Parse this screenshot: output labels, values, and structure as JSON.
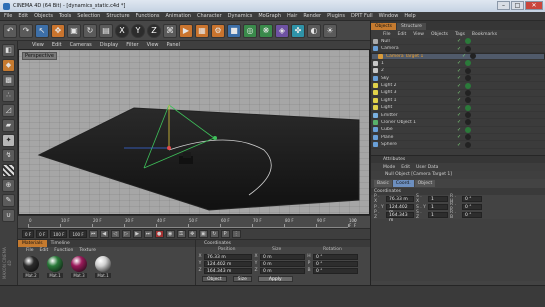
{
  "window": {
    "title": "CINEMA 4D (64 Bit) - [dynamics_static.c4d *]",
    "minimize_glyph": "–",
    "maximize_glyph": "□",
    "close_glyph": "✕"
  },
  "menubar": [
    "File",
    "Edit",
    "Objects",
    "Tools",
    "Selection",
    "Structure",
    "Functions",
    "Animation",
    "Character",
    "Dynamics",
    "MoGraph",
    "Hair",
    "Render",
    "Plugins",
    "DPIT Full",
    "Window",
    "Help"
  ],
  "toolbar": {
    "axis_x": "X",
    "axis_y": "Y",
    "axis_z": "Z"
  },
  "viewport": {
    "menu": [
      "View",
      "Edit",
      "Cameras",
      "Display",
      "Filter",
      "View",
      "Panel"
    ],
    "label": "Perspective"
  },
  "timeline": {
    "ticks": [
      "0",
      "10 F",
      "20 F",
      "30 F",
      "40 F",
      "50 F",
      "60 F",
      "70 F",
      "80 F",
      "90 F",
      "100 F"
    ],
    "end_marker": "0 F"
  },
  "playback": {
    "start": "0 F",
    "current": "0 F",
    "end": "100 F",
    "max": "100 F"
  },
  "materials": {
    "tabs": [
      "Materials",
      "Timeline"
    ],
    "active_tab": "Materials",
    "menu": [
      "File",
      "Edit",
      "Function",
      "Texture"
    ],
    "items": [
      {
        "name": "Mat.2",
        "color": "#2b2b2b"
      },
      {
        "name": "Mat.1",
        "color": "#2a7a3a"
      },
      {
        "name": "Mat.3",
        "color": "#9a1a5a"
      },
      {
        "name": "Mat.1",
        "color": "#cfcfcf"
      }
    ]
  },
  "coordinates": {
    "title": "Coordinates",
    "headers": [
      "Position",
      "Size",
      "Rotation"
    ],
    "rows": [
      {
        "axis": "X",
        "pos": "76.33 m",
        "size": "0 m",
        "rot_label": "H",
        "rot": "0 °"
      },
      {
        "axis": "Y",
        "pos": "124.402 m",
        "size": "0 m",
        "rot_label": "P",
        "rot": "0 °"
      },
      {
        "axis": "Z",
        "pos": "164.343 m",
        "size": "0 m",
        "rot_label": "B",
        "rot": "0 °"
      }
    ],
    "mode": "Object",
    "size_mode": "Size",
    "apply": "Apply"
  },
  "objects_panel": {
    "tabs": [
      "Objects",
      "Structure"
    ],
    "active_tab": "Objects",
    "menu": [
      "File",
      "Edit",
      "View",
      "Objects",
      "Tags",
      "Bookmarks"
    ],
    "items": [
      {
        "name": "Null",
        "color": "#aaaaaa",
        "highlight": false,
        "selected": false
      },
      {
        "name": "Camera",
        "color": "#6aa0d8",
        "highlight": false,
        "selected": false
      },
      {
        "name": "Camera Target 1",
        "color": "#d89a3a",
        "highlight": true,
        "selected": true
      },
      {
        "name": "1",
        "color": "#c8c8c8",
        "highlight": false,
        "selected": false
      },
      {
        "name": "2",
        "color": "#c8c8c8",
        "highlight": false,
        "selected": false
      },
      {
        "name": "Sky",
        "color": "#6aa0d8",
        "highlight": false,
        "selected": false
      },
      {
        "name": "Light 2",
        "color": "#e0d24a",
        "highlight": false,
        "selected": false
      },
      {
        "name": "Light 3",
        "color": "#e0d24a",
        "highlight": false,
        "selected": false
      },
      {
        "name": "Light 1",
        "color": "#e0d24a",
        "highlight": false,
        "selected": false
      },
      {
        "name": "Light",
        "color": "#e0d24a",
        "highlight": false,
        "selected": false
      },
      {
        "name": "Emitter",
        "color": "#7ab0e0",
        "highlight": false,
        "selected": false
      },
      {
        "name": "Cloner Object 1",
        "color": "#58b06a",
        "highlight": false,
        "selected": false
      },
      {
        "name": "Cube",
        "color": "#6aa0d8",
        "highlight": false,
        "selected": false
      },
      {
        "name": "Plane",
        "color": "#6aa0d8",
        "highlight": false,
        "selected": false
      },
      {
        "name": "Sphere",
        "color": "#6aa0d8",
        "highlight": false,
        "selected": false
      }
    ]
  },
  "attributes": {
    "title": "Attributes",
    "menu": [
      "Mode",
      "Edit",
      "User Data"
    ],
    "object_name": "Null Object [Camera Target 1]",
    "tabs": [
      "Basic",
      "Coord.",
      "Object"
    ],
    "active_tab": "Coord.",
    "section": "Coordinates",
    "rows": [
      {
        "p_label": "P . X",
        "p": "76.33 m",
        "s_label": "S . X",
        "s": "1",
        "r_label": "R . H",
        "r": "0 °"
      },
      {
        "p_label": "P . Y",
        "p": "124.402 m",
        "s_label": "S . Y",
        "s": "1",
        "r_label": "R . P",
        "r": "0 °"
      },
      {
        "p_label": "P . Z",
        "p": "164.343 m",
        "s_label": "S . Z",
        "s": "1",
        "r_label": "R . B",
        "r": "0 °"
      }
    ]
  },
  "logo_text": "MAXON CINEMA 4D"
}
